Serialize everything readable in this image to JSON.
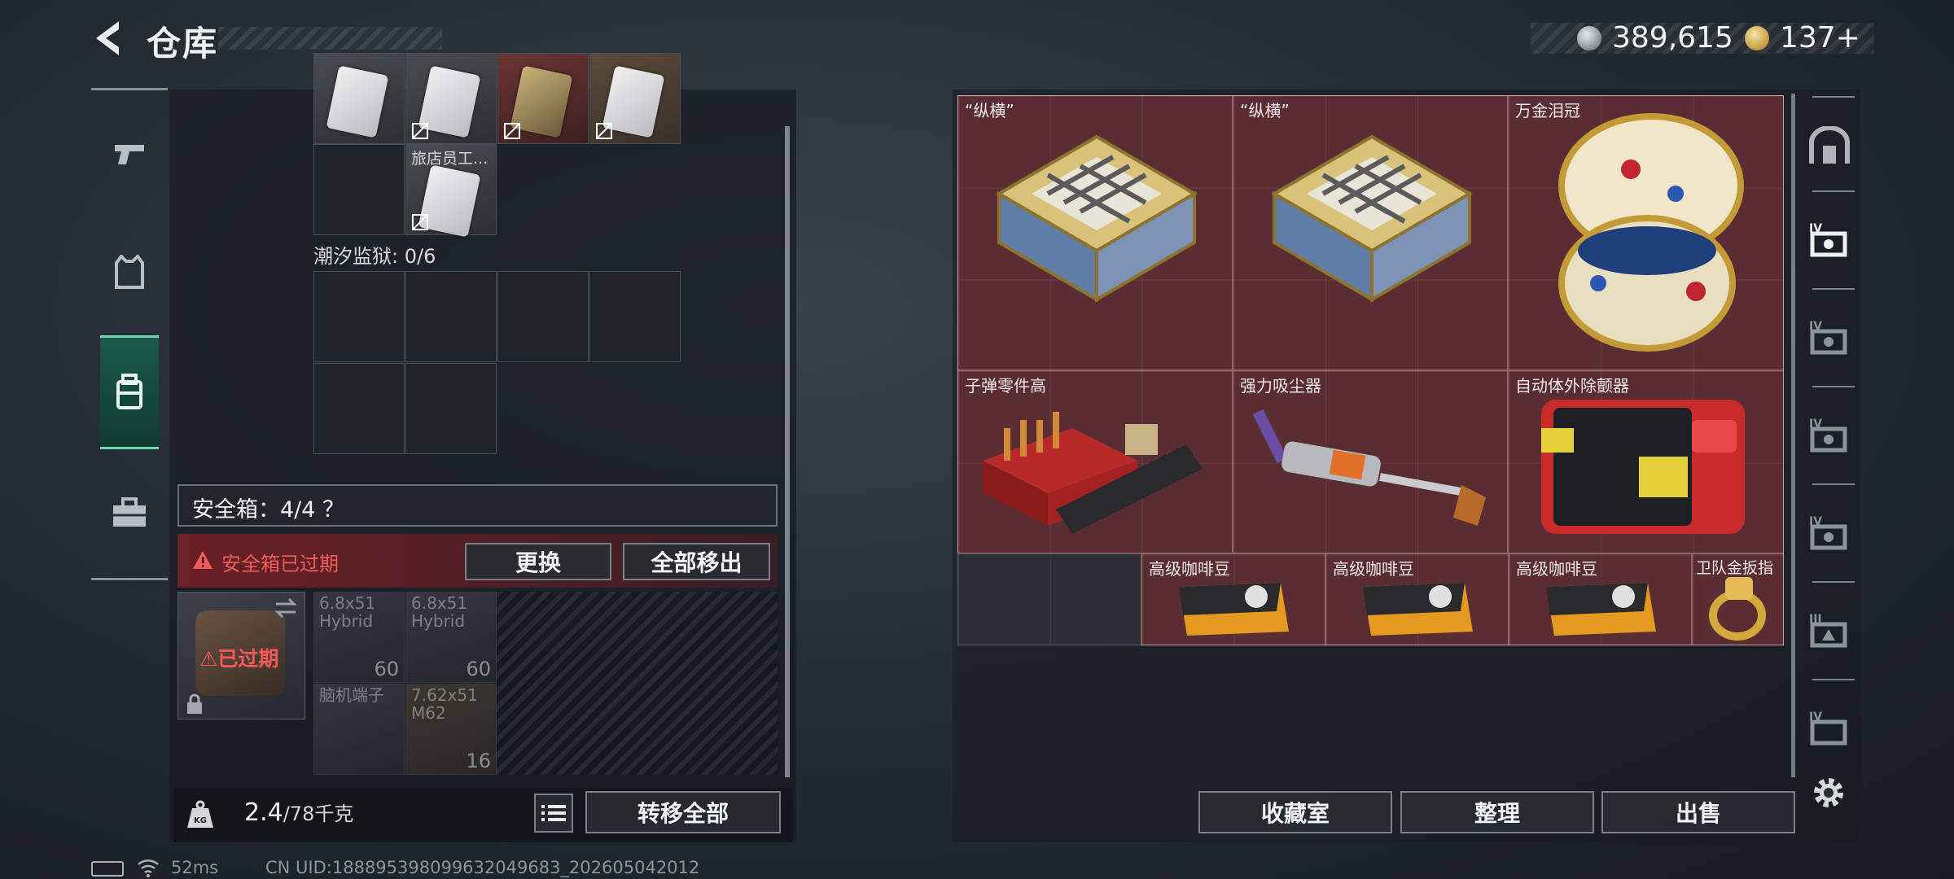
{
  "header": {
    "title": "仓库"
  },
  "currency": {
    "silver": "389,615",
    "gold": "137+"
  },
  "left_tabs": [
    {
      "icon": "pistol-icon"
    },
    {
      "icon": "vest-icon"
    },
    {
      "icon": "backpack-icon"
    },
    {
      "icon": "briefcase-icon"
    }
  ],
  "inventory": {
    "item_label": "旅店员工...",
    "prison_label": "潮汐监狱: 0/6",
    "safe_label": "安全箱：4/4 ？",
    "warning": "安全箱已过期",
    "replace_button": "更换",
    "move_all_button": "全部移出",
    "expired_badge": "已过期",
    "ammo": [
      {
        "name": "6.8x51\nHybrid",
        "count": "60"
      },
      {
        "name": "6.8x51\nHybrid",
        "count": "60"
      },
      {
        "name": "脑机端子",
        "count": ""
      },
      {
        "name": "7.62x51\nM62",
        "count": "16"
      }
    ],
    "weight": "2.4",
    "weight_unit": "/78千克",
    "transfer_button": "转移全部"
  },
  "collection": {
    "items": [
      {
        "label": "“纵横”",
        "icon": "chess-board-icon"
      },
      {
        "label": "“纵横”",
        "icon": "chess-board-icon"
      },
      {
        "label": "万金泪冠",
        "icon": "jeweled-egg-icon"
      },
      {
        "label": "子弹零件高",
        "icon": "ammo-parts-icon"
      },
      {
        "label": "强力吸尘器",
        "icon": "vacuum-icon"
      },
      {
        "label": "自动体外除颤器",
        "icon": "aed-icon"
      },
      {
        "label": "高级咖啡豆",
        "icon": "coffee-bag-icon"
      },
      {
        "label": "高级咖啡豆",
        "icon": "coffee-bag-icon"
      },
      {
        "label": "高级咖啡豆",
        "icon": "coffee-bag-icon"
      },
      {
        "label": "卫队金扳指",
        "icon": "gold-ring-icon"
      }
    ],
    "buttons": {
      "collection": "收藏室",
      "sort": "整理",
      "sell": "出售"
    }
  },
  "status_bar": {
    "ping": "52ms",
    "uid": "CN UID:188895398099632049683_202605042012"
  },
  "colors": {
    "accent_green": "#6fd8b0",
    "grid_red": "#5a2d33",
    "warning_red": "#f05b5b"
  }
}
